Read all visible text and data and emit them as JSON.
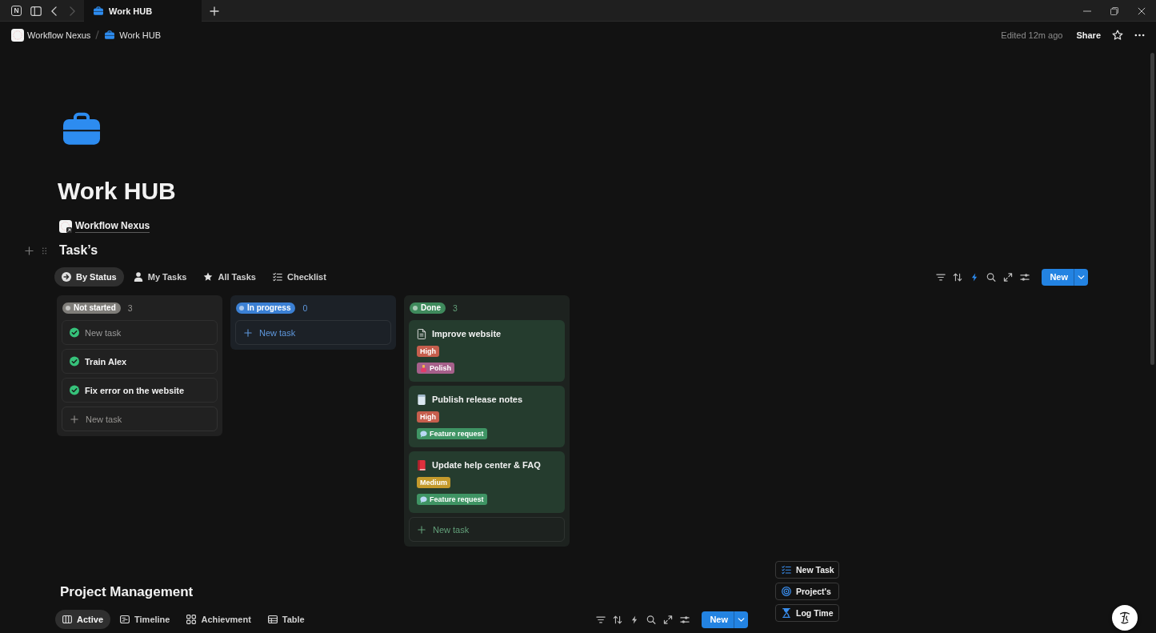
{
  "titlebar": {
    "logo": "N",
    "back_disabled": false,
    "forward_disabled": true,
    "tab": {
      "title": "Work HUB",
      "selected": true
    }
  },
  "topbar": {
    "breadcrumbs": [
      {
        "label": "Workflow Nexus"
      },
      {
        "label": "Work HUB"
      }
    ],
    "edited": "Edited 12m ago",
    "share": "Share"
  },
  "page": {
    "title": "Work HUB",
    "link": "Workflow Nexus"
  },
  "tasks": {
    "heading": "Task’s",
    "views": [
      {
        "label": "By Status",
        "selected": true
      },
      {
        "label": "My Tasks",
        "selected": false
      },
      {
        "label": "All Tasks",
        "selected": false
      },
      {
        "label": "Checklist",
        "selected": false
      }
    ],
    "automation_on": true,
    "new_button": "New",
    "columns": [
      {
        "status": "Not started",
        "color": "#7f7d79",
        "count": "3",
        "cards": [
          {
            "placeholder": "New task"
          },
          {
            "title": "Train Alex"
          },
          {
            "title": "Fix error on the website"
          }
        ],
        "add_label": "New task"
      },
      {
        "status": "In progress",
        "color": "#3b80d4",
        "count": "0",
        "add_label": "New task"
      },
      {
        "status": "Done",
        "color": "#3f8a5c",
        "count": "3",
        "cards": [
          {
            "title": "Improve website",
            "tags": [
              {
                "label": "High",
                "color": "#c65e4d",
                "kind": "plain"
              },
              {
                "label": "Polish",
                "color": "#a6608b",
                "kind": "emoji"
              }
            ]
          },
          {
            "title": "Publish release notes",
            "tags": [
              {
                "label": "High",
                "color": "#c65e4d",
                "kind": "plain"
              },
              {
                "label": "Feature request",
                "color": "#3f9464",
                "kind": "emoji"
              }
            ]
          },
          {
            "title": "Update help center & FAQ",
            "tags": [
              {
                "label": "Medium",
                "color": "#c49a2c",
                "kind": "plain"
              },
              {
                "label": "Feature request",
                "color": "#3f9464",
                "kind": "emoji"
              }
            ]
          }
        ],
        "add_label": "New task"
      }
    ]
  },
  "projects": {
    "heading": "Project Management",
    "views": [
      {
        "label": "Active",
        "selected": true
      },
      {
        "label": "Timeline",
        "selected": false
      },
      {
        "label": "Achievment",
        "selected": false
      },
      {
        "label": "Table",
        "selected": false
      }
    ],
    "automation_on": false,
    "new_button": "New",
    "buttons": [
      {
        "label": "New Task"
      },
      {
        "label": "Project's"
      },
      {
        "label": "Log Time"
      }
    ]
  }
}
